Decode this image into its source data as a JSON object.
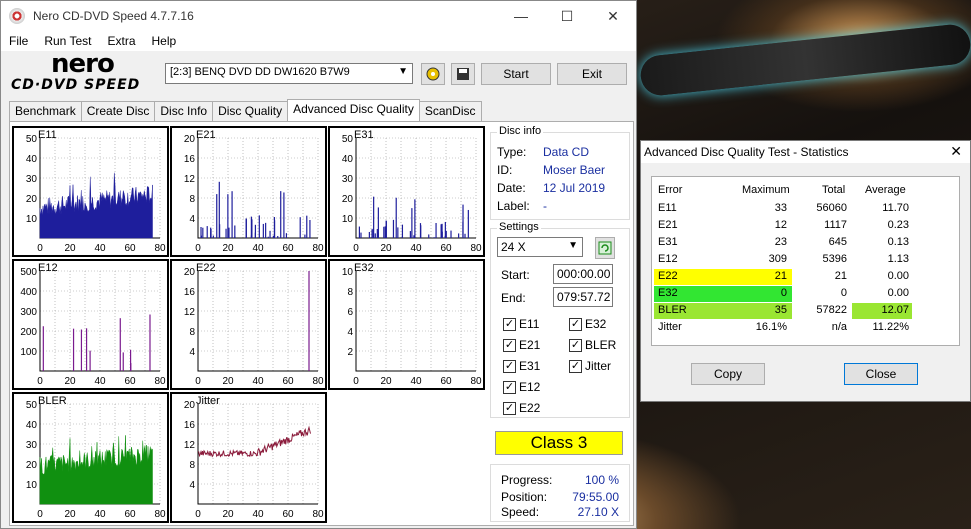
{
  "window": {
    "title": "Nero CD-DVD Speed 4.7.7.16",
    "minimize": "—",
    "maximize": "☐",
    "close": "✕"
  },
  "menu": [
    "File",
    "Run Test",
    "Extra",
    "Help"
  ],
  "logo": {
    "top": "nero",
    "bottom": "CD·DVD SPEED"
  },
  "toolbar": {
    "drive": "[2:3]   BENQ DVD DD DW1620 B7W9",
    "start": "Start",
    "exit": "Exit"
  },
  "tabs": [
    "Benchmark",
    "Create Disc",
    "Disc Info",
    "Disc Quality",
    "Advanced Disc Quality",
    "ScanDisc"
  ],
  "disc_info": {
    "header": "Disc info",
    "type_label": "Type:",
    "type": "Data CD",
    "id_label": "ID:",
    "id": "Moser Baer",
    "date_label": "Date:",
    "date": "12 Jul 2019",
    "label_label": "Label:",
    "label": "-"
  },
  "settings": {
    "header": "Settings",
    "speed": "24 X",
    "start_label": "Start:",
    "start": "000:00.00",
    "end_label": "End:",
    "end": "079:57.72"
  },
  "checks": {
    "e11": "E11",
    "e21": "E21",
    "e31": "E31",
    "e12": "E12",
    "e22": "E22",
    "e32": "E32",
    "bler": "BLER",
    "jitter": "Jitter",
    "mark": "✓"
  },
  "class_label": "Class 3",
  "progress": {
    "progress_label": "Progress:",
    "progress": "100 %",
    "position_label": "Position:",
    "position": "79:55.00",
    "speed_label": "Speed:",
    "speed": "27.10 X"
  },
  "colors": {
    "e11": "#1e1e9c",
    "e12": "#7a1a8e",
    "bler": "#109010",
    "jitter": "#8a1a3a",
    "yellow": "#ffff00",
    "green": "#32e632",
    "lime": "#9ae632"
  },
  "chart_data": [
    {
      "type": "bar",
      "title": "E11",
      "ylim": [
        0,
        50
      ],
      "yticks": [
        10,
        20,
        30,
        40,
        50
      ],
      "xticks": [
        0,
        20,
        40,
        60,
        80
      ],
      "color": "#1e1e9c",
      "profile": "dense",
      "max": 33
    },
    {
      "type": "bar",
      "title": "E21",
      "ylim": [
        0,
        20
      ],
      "yticks": [
        4,
        8,
        12,
        16,
        20
      ],
      "xticks": [
        0,
        20,
        40,
        60,
        80
      ],
      "color": "#1e1e9c",
      "profile": "sparse",
      "max": 12
    },
    {
      "type": "bar",
      "title": "E31",
      "ylim": [
        0,
        50
      ],
      "yticks": [
        10,
        20,
        30,
        40,
        50
      ],
      "xticks": [
        0,
        20,
        40,
        60,
        80
      ],
      "color": "#1e1e9c",
      "profile": "sparse",
      "max": 23
    },
    {
      "type": "bar",
      "title": "E12",
      "ylim": [
        0,
        500
      ],
      "yticks": [
        100,
        200,
        300,
        400,
        500
      ],
      "xticks": [
        0,
        20,
        40,
        60,
        80
      ],
      "color": "#7a1a8e",
      "profile": "spikes",
      "max": 309
    },
    {
      "type": "bar",
      "title": "E22",
      "ylim": [
        0,
        20
      ],
      "yticks": [
        4,
        8,
        12,
        16,
        20
      ],
      "xticks": [
        0,
        20,
        40,
        60,
        80
      ],
      "color": "#7a1a8e",
      "profile": "single",
      "max": 21
    },
    {
      "type": "bar",
      "title": "E32",
      "ylim": [
        0,
        10
      ],
      "yticks": [
        2,
        4,
        6,
        8,
        10
      ],
      "xticks": [
        0,
        20,
        40,
        60,
        80
      ],
      "color": "#7a1a8e",
      "profile": "empty",
      "max": 0
    },
    {
      "type": "area",
      "title": "BLER",
      "ylim": [
        0,
        50
      ],
      "yticks": [
        10,
        20,
        30,
        40,
        50
      ],
      "xticks": [
        0,
        20,
        40,
        60,
        80
      ],
      "color": "#109010",
      "profile": "dense",
      "max": 35
    },
    {
      "type": "line",
      "title": "Jitter",
      "ylim": [
        0,
        20
      ],
      "yticks": [
        4,
        8,
        12,
        16,
        20
      ],
      "xticks": [
        0,
        20,
        40,
        60,
        80
      ],
      "color": "#8a1a3a",
      "profile": "jitter",
      "max": 16.1
    }
  ],
  "stats": {
    "title": "Advanced Disc Quality Test - Statistics",
    "close_x": "✕",
    "headers": [
      "Error",
      "Maximum",
      "Total",
      "Average"
    ],
    "rows": [
      {
        "error": "E11",
        "max": "33",
        "total": "56060",
        "avg": "11.70"
      },
      {
        "error": "E21",
        "max": "12",
        "total": "1117",
        "avg": "0.23"
      },
      {
        "error": "E31",
        "max": "23",
        "total": "645",
        "avg": "0.13"
      },
      {
        "error": "E12",
        "max": "309",
        "total": "5396",
        "avg": "1.13"
      },
      {
        "error": "E22",
        "max": "21",
        "total": "21",
        "avg": "0.00"
      },
      {
        "error": "E32",
        "max": "0",
        "total": "0",
        "avg": "0.00"
      },
      {
        "error": "BLER",
        "max": "35",
        "total": "57822",
        "avg": "12.07"
      },
      {
        "error": "Jitter",
        "max": "16.1%",
        "total": "n/a",
        "avg": "11.22%"
      }
    ],
    "copy": "Copy",
    "close": "Close"
  }
}
